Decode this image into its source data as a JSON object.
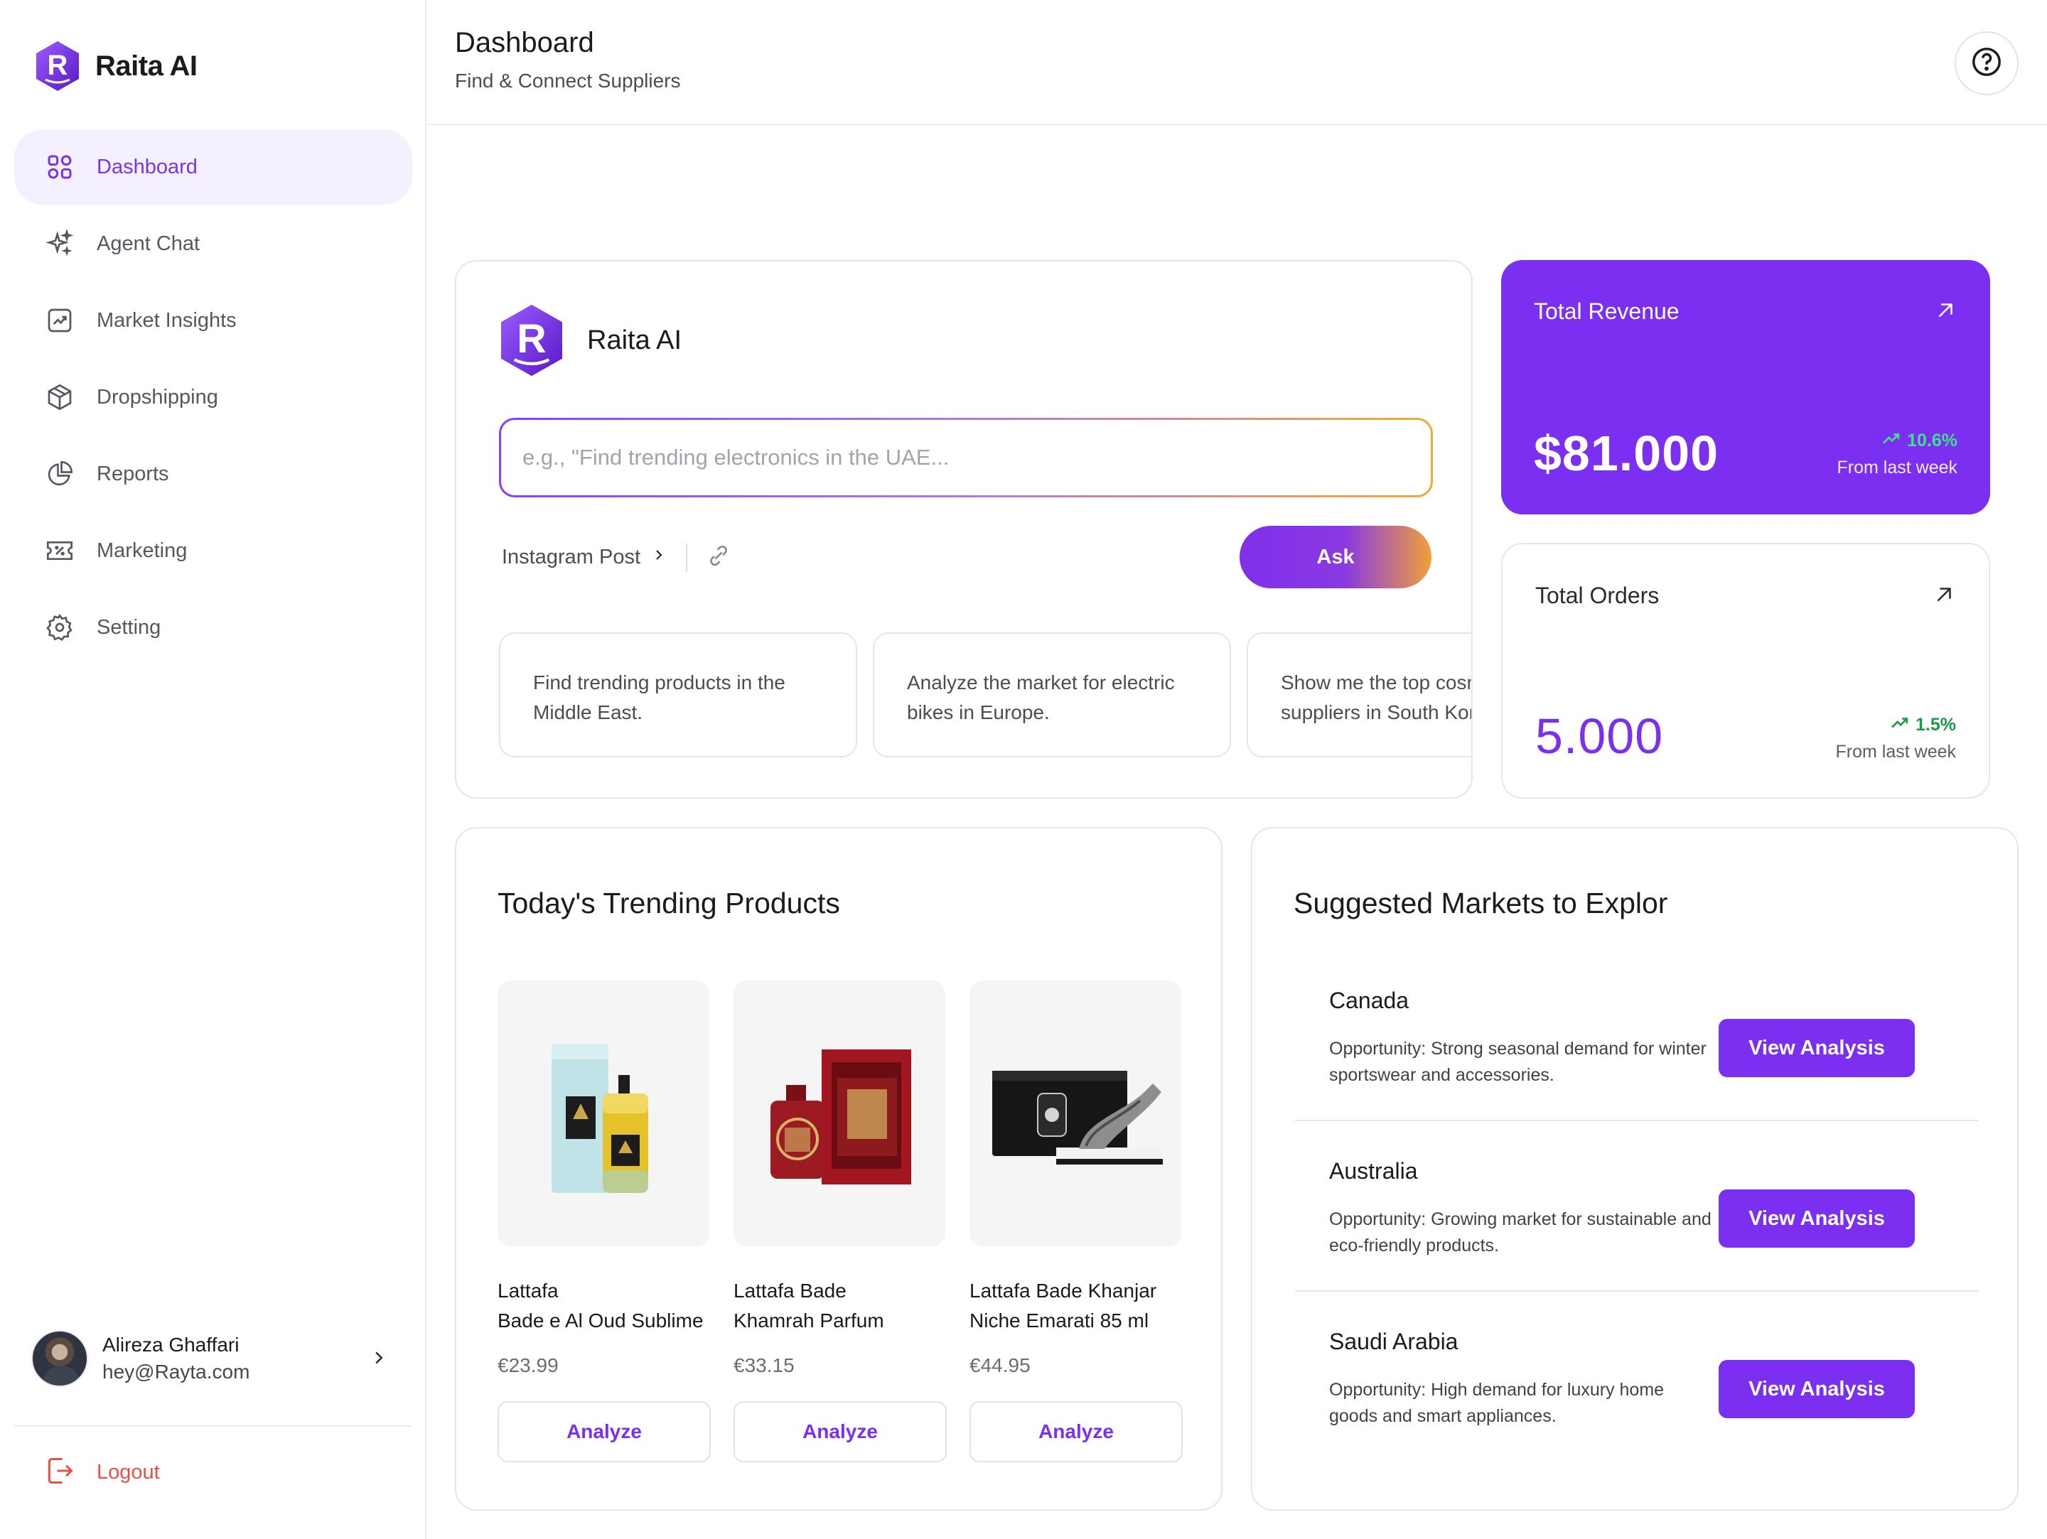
{
  "brand": {
    "name": "Raita AI",
    "logo_letter": "R"
  },
  "sidebar": {
    "items": [
      {
        "label": "Dashboard",
        "icon": "grid-icon",
        "active": true
      },
      {
        "label": "Agent Chat",
        "icon": "sparkles-icon"
      },
      {
        "label": "Market Insights",
        "icon": "chart-icon"
      },
      {
        "label": "Dropshipping",
        "icon": "box-icon"
      },
      {
        "label": "Reports",
        "icon": "pie-chart-icon"
      },
      {
        "label": "Marketing",
        "icon": "ticket-icon"
      },
      {
        "label": "Setting",
        "icon": "gear-icon"
      }
    ],
    "user": {
      "name": "Alireza Ghaffari",
      "email": "hey@Rayta.com"
    },
    "logout_label": "Logout"
  },
  "header": {
    "title": "Dashboard",
    "subtitle": "Find & Connect Suppliers",
    "help_icon": "help-circle-icon"
  },
  "assistant": {
    "name": "Raita AI",
    "placeholder": "e.g., \"Find trending electronics in the UAE...",
    "tool_label": "Instagram Post",
    "ask_label": "Ask",
    "suggestions": [
      "Find trending products in the\nMiddle East.",
      "Analyze the market for electric\nbikes in Europe.",
      "Show me the top cosmetics\nsuppliers in South Korea."
    ]
  },
  "stats": {
    "revenue": {
      "title": "Total Revenue",
      "value": "$81.000",
      "delta": "10.6%",
      "from": "From last week"
    },
    "orders": {
      "title": "Total Orders",
      "value": "5.000",
      "delta": "1.5%",
      "from": "From last week"
    }
  },
  "trending": {
    "title": "Today's Trending Products",
    "analyze_label": "Analyze",
    "products": [
      {
        "name": "Lattafa\nBade e Al Oud Sublime",
        "price": "€23.99"
      },
      {
        "name": "Lattafa Bade\nKhamrah  Parfum",
        "price": "€33.15"
      },
      {
        "name": "Lattafa Bade Khanjar\nNiche Emarati 85 ml",
        "price": "€44.95"
      }
    ]
  },
  "markets": {
    "title": "Suggested Markets to Explor",
    "button_label": "View Analysis",
    "items": [
      {
        "name": "Canada",
        "desc": "Opportunity: Strong seasonal demand for winter sportswear and accessories."
      },
      {
        "name": "Australia",
        "desc": "Opportunity: Growing market for sustainable and eco-friendly products."
      },
      {
        "name": "Saudi Arabia",
        "desc": "Opportunity: High demand for luxury home goods and smart appliances."
      }
    ]
  },
  "colors": {
    "accent": "#7b2ff0",
    "accent_light": "#f5f0ff",
    "danger": "#e4514b",
    "positive": "#1d9a45",
    "gradient_end": "#f0a03a"
  }
}
